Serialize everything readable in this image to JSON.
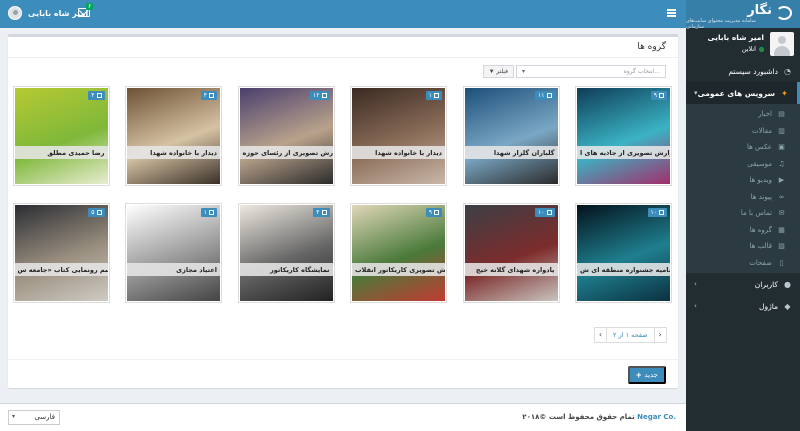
{
  "header": {
    "user_name": "امیر شاه بابایی",
    "mail_count": "۶"
  },
  "sidebar": {
    "brand": "نگار",
    "brand_sub": "سامانه مدیریت محتوای سایت‌های سازمانی",
    "profile_name": "امیر شاه بابایی",
    "status": "انلاین",
    "dashboard": "داشبورد سیستم",
    "public_services": "سرویس های عمومی",
    "sub_items": [
      {
        "label": "اخبار",
        "icon": "newspaper-icon"
      },
      {
        "label": "مقالات",
        "icon": "article-icon"
      },
      {
        "label": "عکس ها",
        "icon": "photo-icon"
      },
      {
        "label": "موسیقی",
        "icon": "music-icon"
      },
      {
        "label": "ویدیو ها",
        "icon": "video-icon"
      },
      {
        "label": "پیوند ها",
        "icon": "link-icon"
      },
      {
        "label": "تماس با ما",
        "icon": "contact-icon"
      },
      {
        "label": "گروه ها",
        "icon": "group-icon"
      },
      {
        "label": "قالب ها",
        "icon": "template-icon"
      },
      {
        "label": "صفحات",
        "icon": "page-icon"
      }
    ],
    "users": "کاربران",
    "modules": "ماژول"
  },
  "main": {
    "title": "گروه ها",
    "select_placeholder": "انتخاب گروه...",
    "filter_label": "فیلتر",
    "cards": [
      {
        "caption": "گزارش تصویری از جاذبه های ا...",
        "count": "۹",
        "colors": [
          "#0e3d57",
          "#3bb3c4",
          "#a22f6b"
        ]
      },
      {
        "caption": "گلباران گلزار شهدا",
        "count": "۱۱",
        "colors": [
          "#1d4f7a",
          "#7aa7c4",
          "#2b2b2b"
        ]
      },
      {
        "caption": "دیدار با خانواده شهدا",
        "count": "۱",
        "colors": [
          "#3a2a22",
          "#8c6e5a",
          "#c9b7a8"
        ]
      },
      {
        "caption": "گزارش تصویری از رئسای حوزه...",
        "count": "۱۲",
        "colors": [
          "#4a3f6e",
          "#b9a28b",
          "#2b2b2b"
        ]
      },
      {
        "caption": "دیدار با خانواده شهدا",
        "count": "۴",
        "colors": [
          "#6e5134",
          "#d6c3a4",
          "#3a3028"
        ]
      },
      {
        "caption": "رضا حمیدی مطلق",
        "count": "۴",
        "colors": [
          "#b6c933",
          "#7fb83a",
          "#e8ecd1"
        ]
      },
      {
        "caption": "اختتامیه جشنواره منطقه ای ش...",
        "count": "۱۰",
        "colors": [
          "#04121c",
          "#1f7f8f",
          "#0b3140"
        ]
      },
      {
        "caption": "یادواره شهدای گلانه خیج",
        "count": "۱۰",
        "colors": [
          "#3b3f45",
          "#7d2c2c",
          "#c8c4be"
        ]
      },
      {
        "caption": "گزارش تصویری کاریکاتور انقلاب",
        "count": "۹",
        "colors": [
          "#e0d7b8",
          "#4a7a3a",
          "#c23b32"
        ]
      },
      {
        "caption": "نمایشگاه کاریکاتور",
        "count": "۴",
        "colors": [
          "#ede8e0",
          "#666",
          "#222"
        ]
      },
      {
        "caption": "اعتیاد مجازی",
        "count": "۱",
        "colors": [
          "#ffffff",
          "#999",
          "#444"
        ]
      },
      {
        "caption": "مراسم رونمایی کتاب «جامعه س...",
        "count": "۵",
        "colors": [
          "#2b2d33",
          "#9a8f7f",
          "#cfcac3"
        ]
      }
    ],
    "pager_label": "صفحه ۱ از ۲",
    "prev": "‹",
    "next": "›",
    "new_label": "جدید"
  },
  "footer": {
    "copyright": "تمام حقوق محفوظ است ©۲۰۱۸",
    "brand": "Negar Co.",
    "language": "فارسی"
  }
}
